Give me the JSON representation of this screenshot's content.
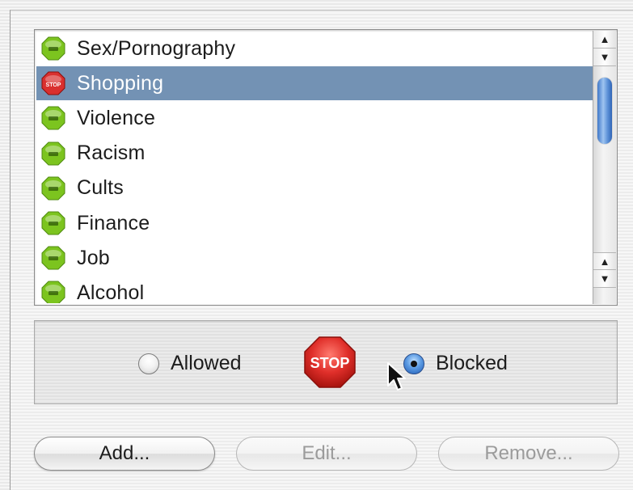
{
  "categories": {
    "items": [
      {
        "label": "Sex/Pornography",
        "status": "allowed",
        "icon": "go-icon"
      },
      {
        "label": "Shopping",
        "status": "blocked",
        "icon": "stop-icon",
        "selected": true
      },
      {
        "label": "Violence",
        "status": "allowed",
        "icon": "go-icon"
      },
      {
        "label": "Racism",
        "status": "allowed",
        "icon": "go-icon"
      },
      {
        "label": "Cults",
        "status": "allowed",
        "icon": "go-icon"
      },
      {
        "label": "Finance",
        "status": "allowed",
        "icon": "go-icon"
      },
      {
        "label": "Job",
        "status": "allowed",
        "icon": "go-icon"
      },
      {
        "label": "Alcohol",
        "status": "allowed",
        "icon": "go-icon"
      }
    ]
  },
  "status_panel": {
    "allowed_label": "Allowed",
    "blocked_label": "Blocked",
    "selected": "blocked",
    "stop_sign_text": "STOP"
  },
  "buttons": {
    "add_label": "Add...",
    "edit_label": "Edit...",
    "remove_label": "Remove..."
  },
  "colors": {
    "selection": "#7392b4",
    "go_icon": "#7cc41f",
    "stop_icon": "#d9302f"
  }
}
